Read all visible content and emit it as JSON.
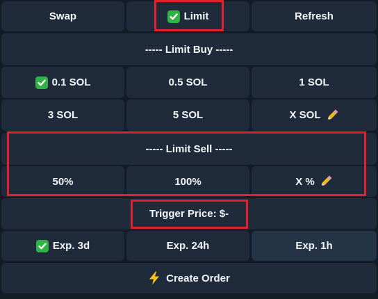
{
  "colors": {
    "background": "#131b27",
    "button": "#1f2b3a",
    "button_selected": "#243446",
    "highlight": "#e3212d",
    "check": "#2fb344"
  },
  "top_row": {
    "swap": "Swap",
    "limit": "Limit",
    "refresh": "Refresh"
  },
  "limit_buy": {
    "header": "----- Limit Buy -----",
    "amounts": [
      "0.1 SOL",
      "0.5 SOL",
      "1 SOL",
      "3 SOL",
      "5 SOL",
      "X SOL"
    ]
  },
  "limit_sell": {
    "header": "----- Limit Sell -----",
    "percents": [
      "50%",
      "100%",
      "X %"
    ]
  },
  "trigger_price": "Trigger Price: $-",
  "expiry": [
    "Exp. 3d",
    "Exp. 24h",
    "Exp. 1h"
  ],
  "create_order": "Create Order",
  "icons": {
    "check": "check-mark-icon",
    "pencil": "pencil-icon",
    "bolt": "lightning-icon"
  }
}
